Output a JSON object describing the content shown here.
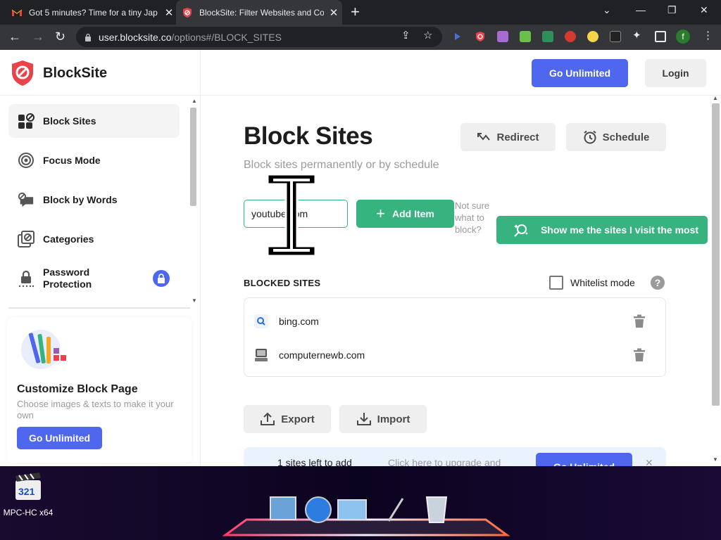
{
  "browser": {
    "tabs": [
      {
        "title": "Got 5 minutes? Time for a tiny Jap",
        "icon": "gmail-icon"
      },
      {
        "title": "BlockSite: Filter Websites and Cor",
        "icon": "blocksite-icon",
        "active": true
      }
    ],
    "url_host": "user.blocksite.co",
    "url_path": "/options#/BLOCK_SITES"
  },
  "app": {
    "brand": "BlockSite",
    "go_unlimited": "Go Unlimited",
    "login": "Login"
  },
  "sidebar": {
    "items": [
      {
        "label": "Block Sites",
        "icon": "block-sites-icon",
        "active": true
      },
      {
        "label": "Focus Mode",
        "icon": "focus-mode-icon"
      },
      {
        "label": "Block by Words",
        "icon": "block-words-icon"
      },
      {
        "label": "Categories",
        "icon": "categories-icon"
      },
      {
        "label": "Password Protection",
        "icon": "lock-icon",
        "badge": "lock"
      }
    ],
    "card": {
      "title": "Customize Block Page",
      "description": "Choose images & texts to make it your own",
      "button": "Go Unlimited"
    }
  },
  "main": {
    "title": "Block Sites",
    "subtitle": "Block sites permanently or by schedule",
    "redirect": "Redirect",
    "schedule": "Schedule",
    "input_value": "youtube.com",
    "add_item": "Add Item",
    "not_sure": "Not sure what to block?",
    "show_me": "Show me the sites I visit the most",
    "blocked_header": "BLOCKED SITES",
    "whitelist_label": "Whitelist mode",
    "whitelist_checked": false,
    "help": "?",
    "blocked_sites": [
      {
        "domain": "bing.com",
        "icon": "bing-search-icon"
      },
      {
        "domain": "computernewb.com",
        "icon": "computer-icon"
      }
    ],
    "export": "Export",
    "import": "Import",
    "banner": {
      "left": "1 sites left to add",
      "middle": "Click here to upgrade and",
      "button": "Go Unlimited"
    }
  },
  "desktop": {
    "app_label": "MPC-HC x64"
  },
  "colors": {
    "primary": "#4f67ef",
    "green": "#36b37e",
    "brand_red": "#e8434b"
  }
}
